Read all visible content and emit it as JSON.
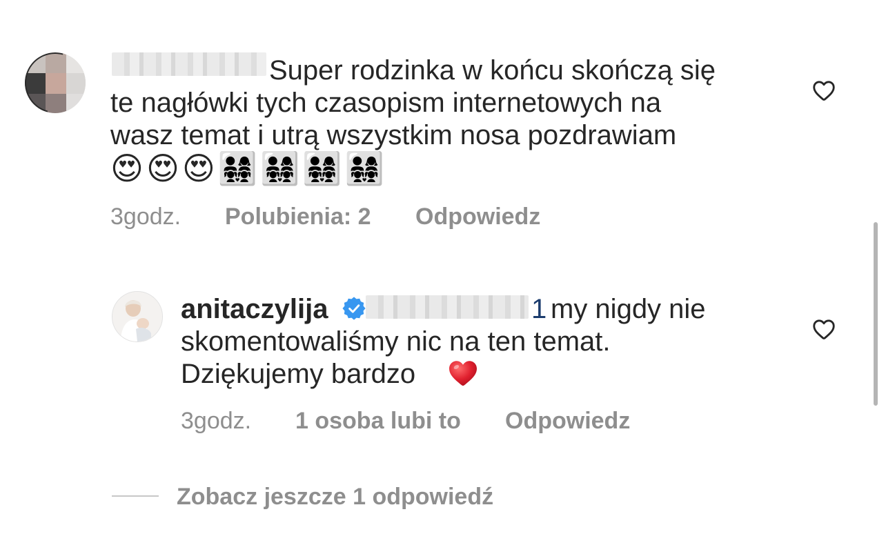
{
  "comments": [
    {
      "line1": "Super rodzinka w końcu skończą się",
      "line2": "te nagłówki tych czasopism internetowych na",
      "line3": "wasz temat i utrą wszystkim nosa pozdrawiam",
      "emojis": "😍😍😍👨‍👩‍👧‍👧👨‍👩‍👧‍👧👨‍👩‍👧‍👧👨‍👩‍👧‍👧",
      "time": "3godz.",
      "likes": "Polubienia: 2",
      "reply_label": "Odpowiedz"
    }
  ],
  "reply": {
    "username": "anitaczylija",
    "mention_tail": "1",
    "line1": "my nigdy nie",
    "line2": "skomentowaliśmy nic na ten temat.",
    "line3": "Dziękujemy bardzo",
    "time": "3godz.",
    "likes": "1 osoba lubi to",
    "reply_label": "Odpowiedz"
  },
  "view_more": "Zobacz jeszcze 1 odpowiedź",
  "icons": {
    "like": "heart-outline-icon",
    "verified": "verified-badge-icon",
    "love": "red-heart-emoji"
  },
  "colors": {
    "text": "#262626",
    "meta": "#8e8e8e",
    "verified": "#3897f0",
    "heart_emoji": "#e0202e"
  }
}
